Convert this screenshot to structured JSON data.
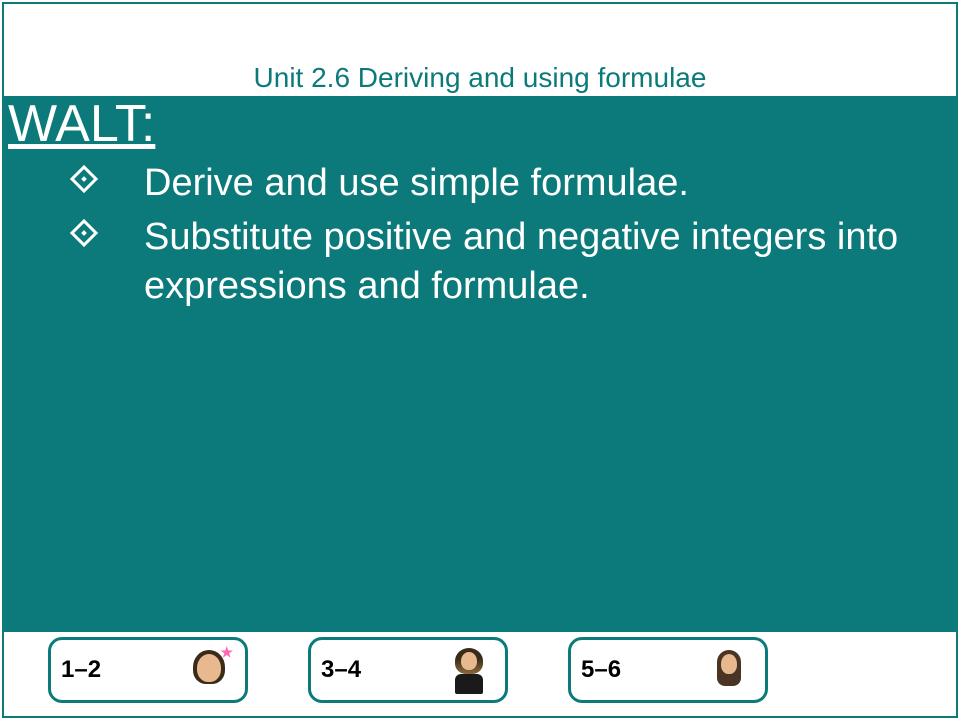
{
  "header": {
    "title": "Unit 2.6 Deriving and using formulae"
  },
  "content": {
    "walt_label": "WALT:",
    "bullets": [
      "Derive and use simple formulae.",
      "Substitute positive and negative integers into expressions and formulae."
    ]
  },
  "footer": {
    "buttons": [
      {
        "label": "1–2",
        "avatar": "excited"
      },
      {
        "label": "3–4",
        "avatar": "sitting"
      },
      {
        "label": "5–6",
        "avatar": "neutral"
      }
    ]
  }
}
